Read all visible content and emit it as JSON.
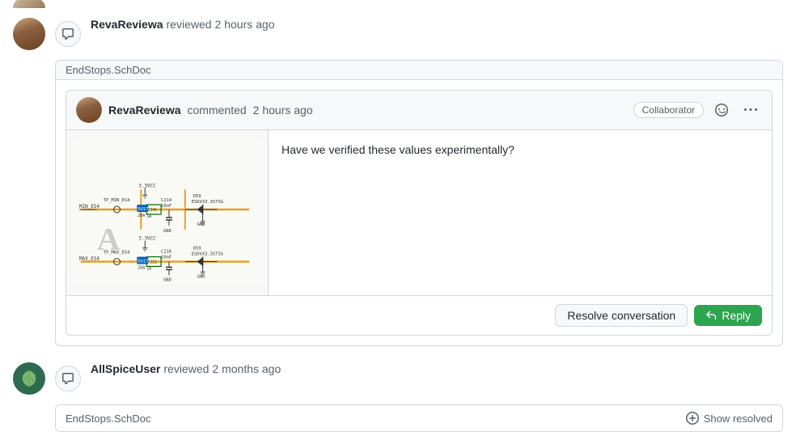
{
  "reviewers": [
    {
      "id": "reva",
      "username": "RevaReviewa",
      "action": "reviewed",
      "timeago": "2 hours ago",
      "file": "EndStops.SchDoc",
      "comment": {
        "username": "RevaReviewa",
        "action": "commented",
        "timeago": "2 hours ago",
        "badge": "Collaborator",
        "text": "Have we verified these values experimentally?"
      },
      "buttons": {
        "resolve": "Resolve conversation",
        "reply": "Reply"
      }
    },
    {
      "id": "allspice",
      "username": "AllSpiceUser",
      "action": "reviewed",
      "timeago": "2 months ago",
      "file": "EndStops.SchDoc",
      "show_resolved": "Show resolved"
    }
  ],
  "icons": {
    "comment_icon": "💬",
    "emoji_icon": "🙂",
    "more_icon": "•••",
    "reply_arrow": "↩",
    "expand_icon": "⤢"
  }
}
